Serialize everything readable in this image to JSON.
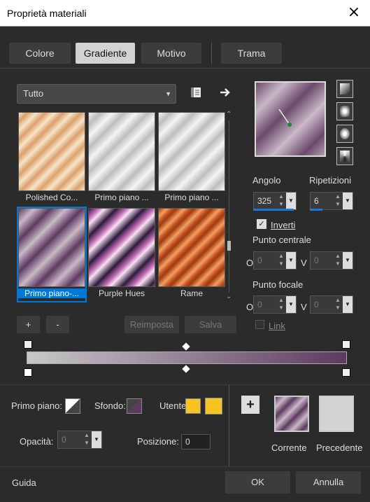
{
  "window": {
    "title": "Proprietà materiali",
    "close_icon": "×"
  },
  "tabs": [
    {
      "label": "Colore"
    },
    {
      "label": "Gradiente"
    },
    {
      "label": "Motivo"
    },
    {
      "label": "Trama"
    }
  ],
  "category": {
    "value": "Tutto"
  },
  "swatches": [
    {
      "label": "Polished Co...",
      "c1": "#f6e4c8",
      "c2": "#c07840"
    },
    {
      "label": "Primo piano ...",
      "c1": "#f2f2f2",
      "c2": "#bdbdbd"
    },
    {
      "label": "Primo piano ...",
      "c1": "#f2f2f2",
      "c2": "#bdbdbd"
    },
    {
      "label": "Primo piano-...",
      "c1": "#c9b8c7",
      "c2": "#5e3a60"
    },
    {
      "label": "Purple Hues",
      "c1": "#f0d6ef",
      "c2": "#2e1a3a"
    },
    {
      "label": "Rame",
      "c1": "#f4a060",
      "c2": "#a03a10"
    }
  ],
  "buttons": {
    "add": "+",
    "remove": "-",
    "reset": "Reimposta",
    "save": "Salva"
  },
  "angle": {
    "label": "Angolo",
    "value": "325"
  },
  "repeats": {
    "label": "Ripetizioni",
    "value": "6"
  },
  "invert": {
    "label": "Inverti",
    "checked": true
  },
  "center_point": {
    "label": "Punto centrale",
    "o_label": "O",
    "o_value": "0",
    "v_label": "V",
    "v_value": "0"
  },
  "focal_point": {
    "label": "Punto focale",
    "o_label": "O",
    "o_value": "0",
    "v_label": "V",
    "v_value": "0"
  },
  "link": {
    "label": "Link"
  },
  "bottom": {
    "foreground_label": "Primo piano:",
    "background_label": "Sfondo:",
    "user_label": "Utente:",
    "opacity_label": "Opacità:",
    "opacity_value": "0",
    "position_label": "Posizione:",
    "position_value": "0",
    "current_label": "Corrente",
    "previous_label": "Precedente",
    "user_color": "#f5c423"
  },
  "footer": {
    "help": "Guida",
    "ok": "OK",
    "cancel": "Annulla"
  }
}
